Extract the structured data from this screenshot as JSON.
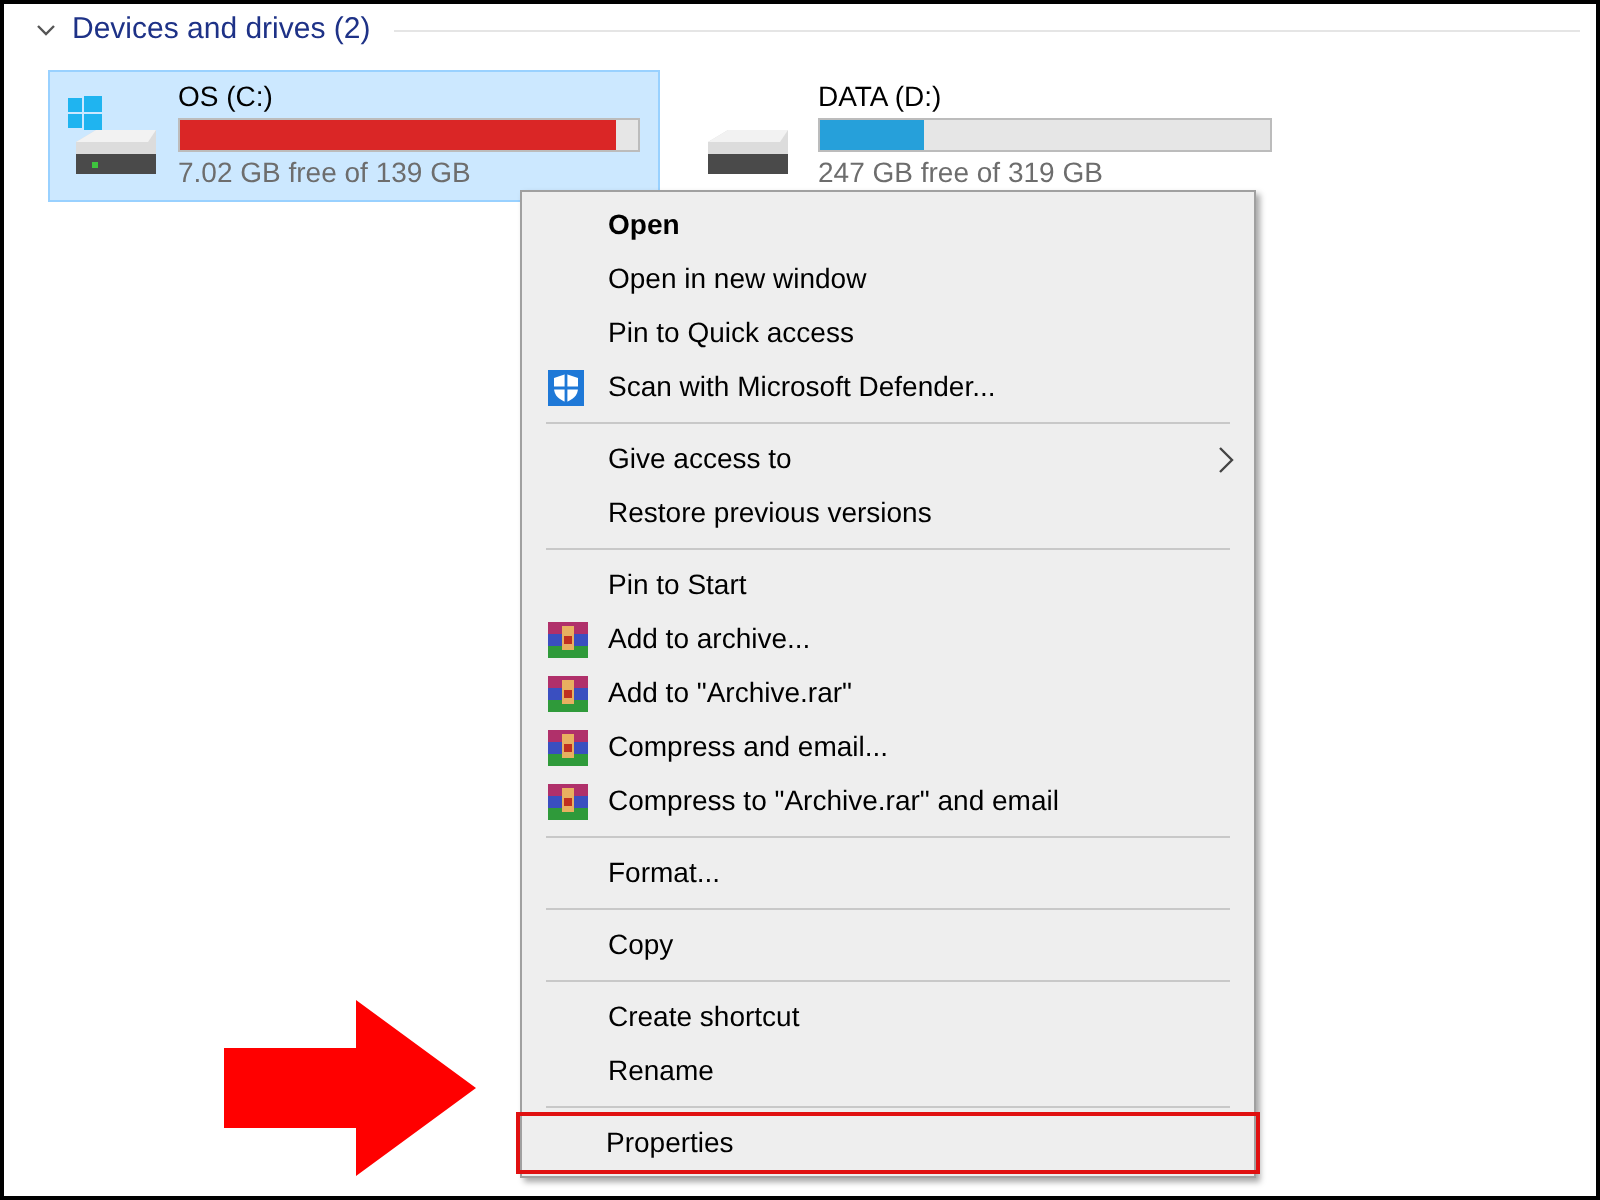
{
  "section": {
    "title": "Devices and drives (2)",
    "expanded": true
  },
  "drives": [
    {
      "kind": "system",
      "name": "OS (C:)",
      "level": 0.95,
      "color": "#da2626",
      "free": "7.02 GB free of 139 GB",
      "selected": true
    },
    {
      "kind": "data",
      "name": "DATA (D:)",
      "level": 0.23,
      "color": "#26a0da",
      "free": "247 GB free of 319 GB",
      "selected": false
    }
  ],
  "context_menu": {
    "groups": [
      [
        {
          "label": "Open",
          "default": true,
          "kind": "plain",
          "submenu": false,
          "highlighted": false
        },
        {
          "label": "Open in new window",
          "default": false,
          "kind": "plain",
          "submenu": false,
          "highlighted": false
        },
        {
          "label": "Pin to Quick access",
          "default": false,
          "kind": "plain",
          "submenu": false,
          "highlighted": false
        },
        {
          "label": "Scan with Microsoft Defender...",
          "default": false,
          "kind": "shield",
          "submenu": false,
          "highlighted": false
        }
      ],
      [
        {
          "label": "Give access to",
          "default": false,
          "kind": "plain",
          "submenu": true,
          "highlighted": false
        },
        {
          "label": "Restore previous versions",
          "default": false,
          "kind": "plain",
          "submenu": false,
          "highlighted": false
        }
      ],
      [
        {
          "label": "Pin to Start",
          "default": false,
          "kind": "plain",
          "submenu": false,
          "highlighted": false
        },
        {
          "label": "Add to archive...",
          "default": false,
          "kind": "archive",
          "submenu": false,
          "highlighted": false
        },
        {
          "label": "Add to \"Archive.rar\"",
          "default": false,
          "kind": "archive",
          "submenu": false,
          "highlighted": false
        },
        {
          "label": "Compress and email...",
          "default": false,
          "kind": "archive",
          "submenu": false,
          "highlighted": false
        },
        {
          "label": "Compress to \"Archive.rar\" and email",
          "default": false,
          "kind": "archive",
          "submenu": false,
          "highlighted": false
        }
      ],
      [
        {
          "label": "Format...",
          "default": false,
          "kind": "plain",
          "submenu": false,
          "highlighted": false
        }
      ],
      [
        {
          "label": "Copy",
          "default": false,
          "kind": "plain",
          "submenu": false,
          "highlighted": false
        }
      ],
      [
        {
          "label": "Create shortcut",
          "default": false,
          "kind": "plain",
          "submenu": false,
          "highlighted": false
        },
        {
          "label": "Rename",
          "default": false,
          "kind": "plain",
          "submenu": false,
          "highlighted": false
        }
      ],
      [
        {
          "label": "Properties",
          "default": false,
          "kind": "plain",
          "submenu": false,
          "highlighted": true
        }
      ]
    ]
  },
  "pointer_arrow": {
    "visible": true
  }
}
